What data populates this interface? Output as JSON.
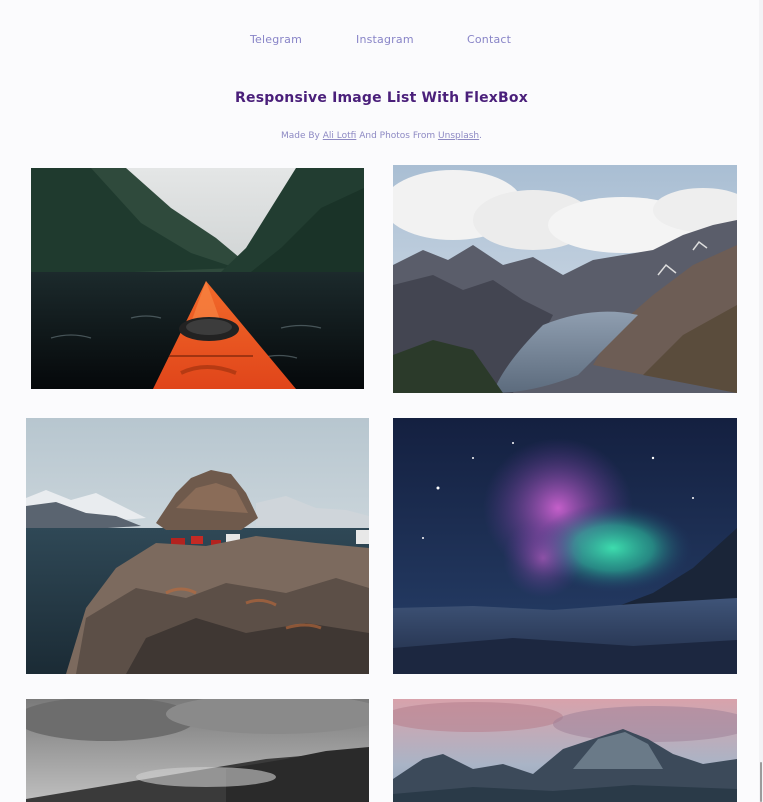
{
  "nav": {
    "links": [
      "Telegram",
      "Instagram",
      "Contact"
    ]
  },
  "header": {
    "title": "Responsive Image List With FlexBox",
    "subtitle_prefix": "Made By ",
    "author": "Ali Lotfi",
    "subtitle_middle": " And Photos From ",
    "source": "Unsplash",
    "subtitle_suffix": "."
  },
  "gallery": {
    "images": [
      {
        "subject": "kayak-fjord"
      },
      {
        "subject": "mountain-lake"
      },
      {
        "subject": "rocky-island-village"
      },
      {
        "subject": "aurora-night"
      },
      {
        "subject": "foggy-hills"
      },
      {
        "subject": "sunset-mountains"
      }
    ]
  },
  "colors": {
    "nav_link": "#8884c7",
    "title": "#4a1f7a",
    "subtitle": "#8d89c3",
    "background": "#fbfbfd"
  }
}
